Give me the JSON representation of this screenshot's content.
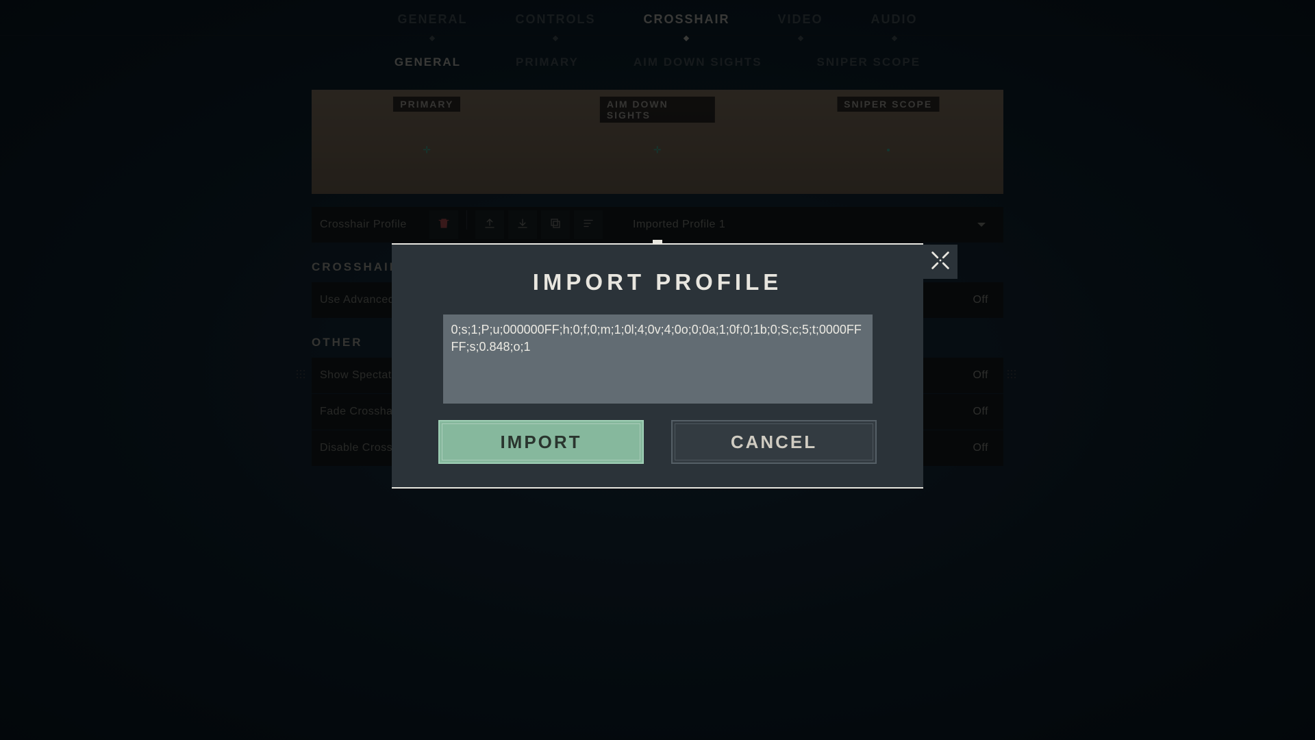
{
  "topNav": {
    "items": [
      {
        "label": "GENERAL"
      },
      {
        "label": "CONTROLS"
      },
      {
        "label": "CROSSHAIR"
      },
      {
        "label": "VIDEO"
      },
      {
        "label": "AUDIO"
      }
    ],
    "activeIndex": 2
  },
  "subNav": {
    "items": [
      {
        "label": "GENERAL"
      },
      {
        "label": "PRIMARY"
      },
      {
        "label": "AIM DOWN SIGHTS"
      },
      {
        "label": "SNIPER SCOPE"
      }
    ],
    "activeIndex": 0
  },
  "preview": {
    "labels": [
      "PRIMARY",
      "AIM DOWN SIGHTS",
      "SNIPER SCOPE"
    ]
  },
  "profileRow": {
    "label": "Crosshair Profile",
    "selected": "Imported Profile 1"
  },
  "sections": {
    "crosshair": {
      "title": "CROSSHAIR",
      "rows": [
        {
          "label": "Use Advanced Options",
          "value": "Off"
        }
      ]
    },
    "other": {
      "title": "OTHER",
      "rows": [
        {
          "label": "Show Spectated Player's Crosshair",
          "value": "Off"
        },
        {
          "label": "Fade Crosshair With Firing Error",
          "value": "Off"
        },
        {
          "label": "Disable Crosshair",
          "value": "Off"
        }
      ]
    }
  },
  "modal": {
    "title": "IMPORT PROFILE",
    "textValue": "0;s;1;P;u;000000FF;h;0;f;0;m;1;0l;4;0v;4;0o;0;0a;1;0f;0;1b;0;S;c;5;t;0000FFFF;s;0.848;o;1",
    "importLabel": "IMPORT",
    "cancelLabel": "CANCEL"
  },
  "closeLabel": "CLOSE SETTINGS"
}
